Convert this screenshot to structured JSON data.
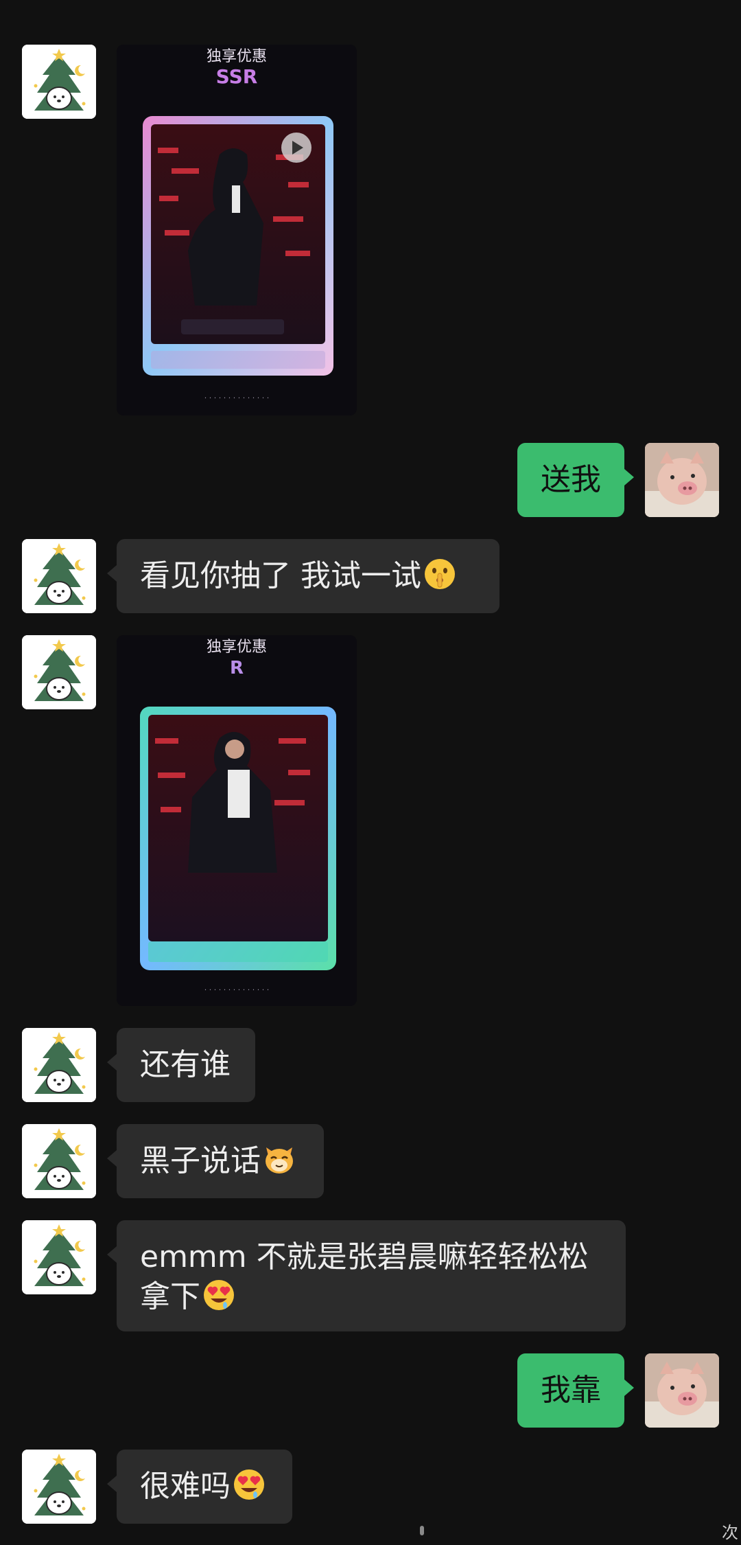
{
  "conversation": {
    "messages": [
      {
        "side": "left",
        "type": "image",
        "image": "gacha-card-ssr"
      },
      {
        "side": "right",
        "type": "text",
        "text": "送我"
      },
      {
        "side": "left",
        "type": "text",
        "text": "看见你抽了  我试一试",
        "emoji": "shushing-face-emoji"
      },
      {
        "side": "left",
        "type": "image",
        "image": "gacha-card-r"
      },
      {
        "side": "left",
        "type": "text",
        "text": "还有谁"
      },
      {
        "side": "left",
        "type": "text",
        "text": "黑子说话",
        "emoji": "cat-face-emoji"
      },
      {
        "side": "left",
        "type": "text",
        "text": "emmm 不就是张碧晨嘛轻轻松松拿下",
        "emoji": "heart-eyes-drool-emoji"
      },
      {
        "side": "right",
        "type": "text",
        "text": "我靠"
      },
      {
        "side": "left",
        "type": "text",
        "text": "很难吗",
        "emoji": "heart-eyes-drool-emoji"
      }
    ]
  },
  "cards": [
    {
      "rarity": "SSR",
      "header": "独享优惠",
      "frame_colors": [
        "#e98ad0",
        "#8fc8f6",
        "#f3c2e6"
      ]
    },
    {
      "rarity": "R",
      "header": "独享优惠",
      "frame_colors": [
        "#53d8bd",
        "#74b9ff",
        "#5be0a8"
      ]
    }
  ],
  "avatars": {
    "contact": "christmas-tree-bear-avatar",
    "me": "piglet-avatar"
  },
  "colors": {
    "background": "#111111",
    "incoming_bubble": "#2c2c2c",
    "outgoing_bubble": "#3bbc6e"
  },
  "bottom": {
    "corner_glyph": "次"
  }
}
